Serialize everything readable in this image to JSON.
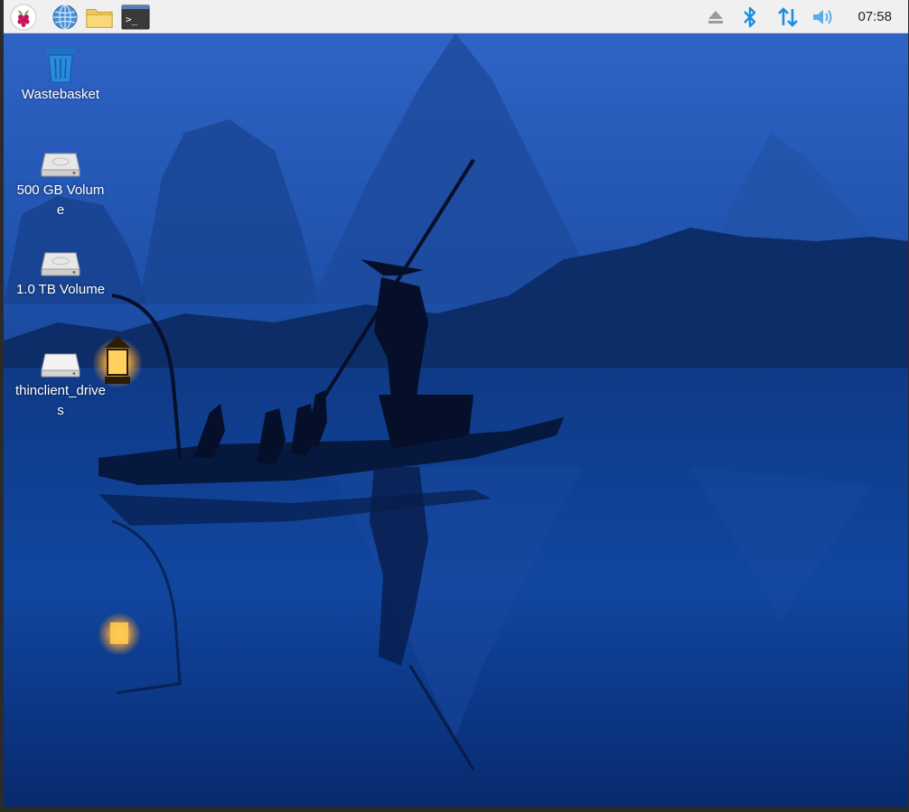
{
  "taskbar": {
    "clock": "07:58",
    "launchers": [
      {
        "name": "raspberry-menu-icon"
      },
      {
        "name": "web-browser-icon"
      },
      {
        "name": "file-manager-icon"
      },
      {
        "name": "terminal-icon",
        "glyph": ">_"
      }
    ],
    "tray": [
      {
        "name": "eject-icon"
      },
      {
        "name": "bluetooth-icon"
      },
      {
        "name": "network-arrows-icon"
      },
      {
        "name": "volume-icon"
      }
    ],
    "colors": {
      "background": "#f0f0f0",
      "tray_accent": "#1a8fe0"
    }
  },
  "desktop": {
    "icons": [
      {
        "label": "Wastebasket",
        "icon": "trash-icon"
      },
      {
        "label": "500 GB Volume",
        "icon": "drive-icon"
      },
      {
        "label": "1.0 TB Volume",
        "icon": "drive-icon"
      },
      {
        "label": "thinclient_drives",
        "icon": "drive-icon"
      }
    ]
  }
}
